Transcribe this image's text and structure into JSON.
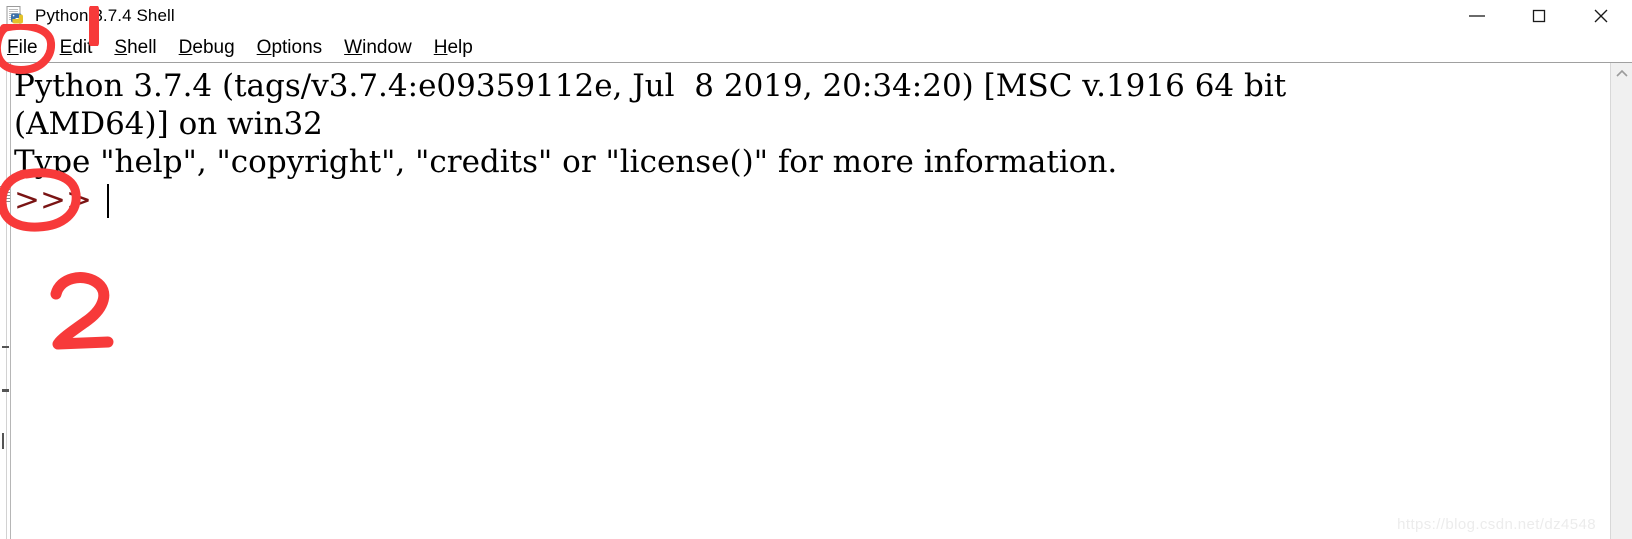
{
  "window": {
    "title": "Python 3.7.4 Shell",
    "icon": "python-idle-icon",
    "controls": {
      "minimize": "minimize-button",
      "maximize": "maximize-button",
      "close": "close-button"
    }
  },
  "menubar": {
    "items": [
      {
        "label": "File",
        "accel": "F",
        "rest": "ile"
      },
      {
        "label": "Edit",
        "accel": "E",
        "rest": "dit"
      },
      {
        "label": "Shell",
        "accel": "S",
        "rest": "hell"
      },
      {
        "label": "Debug",
        "accel": "D",
        "rest": "ebug"
      },
      {
        "label": "Options",
        "accel": "O",
        "rest": "ptions"
      },
      {
        "label": "Window",
        "accel": "W",
        "rest": "indow"
      },
      {
        "label": "Help",
        "accel": "H",
        "rest": "elp"
      }
    ]
  },
  "shell": {
    "lines": [
      "Python 3.7.4 (tags/v3.7.4:e09359112e, Jul  8 2019, 20:34:20) [MSC v.1916 64 bit",
      "(AMD64)] on win32",
      "Type \"help\", \"copyright\", \"credits\" or \"license()\" for more information."
    ],
    "prompt": ">>> ",
    "input_value": "",
    "prompt_color": "#7a1414",
    "text_color": "#000000",
    "background": "#ffffff"
  },
  "annotations": {
    "color": "#f73a3a",
    "marks": [
      {
        "name": "circle-around-file-menu",
        "shape": "oval",
        "label": ""
      },
      {
        "name": "annotation-number-1",
        "shape": "stroke",
        "label": "1"
      },
      {
        "name": "circle-around-prompt",
        "shape": "oval",
        "label": ""
      },
      {
        "name": "annotation-number-2",
        "shape": "numeral",
        "label": "2"
      }
    ]
  },
  "scrollbar": {
    "up_arrow": "scroll-up-arrow-icon",
    "orientation": "vertical",
    "position_percent": 0
  },
  "watermark": {
    "text": "https://blog.csdn.net/dz4548"
  }
}
